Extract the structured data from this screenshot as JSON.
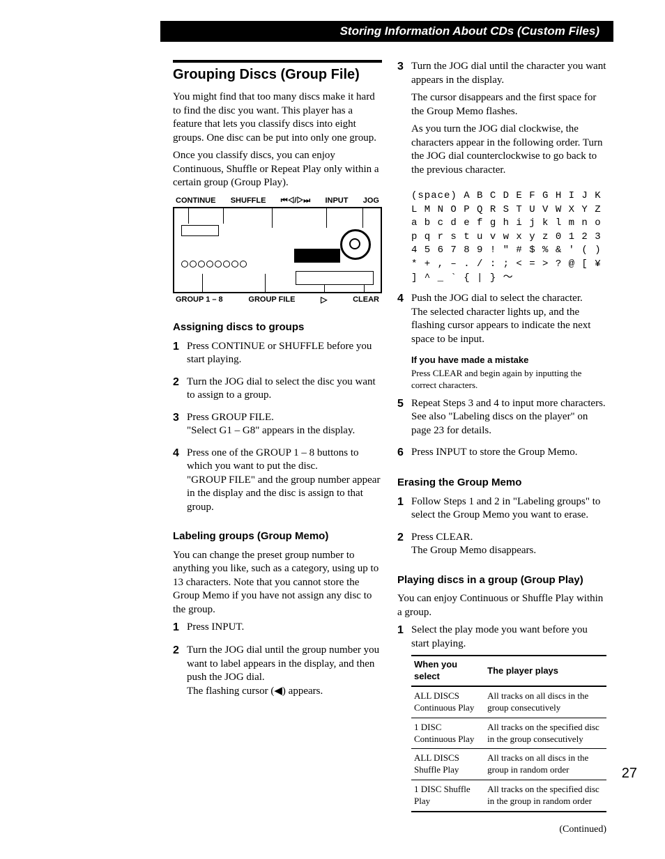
{
  "header": "Storing Information About CDs (Custom Files)",
  "section_title": "Grouping Discs (Group File)",
  "intro1": "You might find that too many discs make it hard to find the disc you want. This player has a feature that lets you classify discs into eight groups. One disc can be put into only one group.",
  "intro2": "Once you classify discs, you can enjoy Continuous, Shuffle or Repeat Play only within a certain group (Group Play).",
  "diagram": {
    "top": [
      "CONTINUE",
      "SHUFFLE",
      "⏮◁/▷⏭",
      "INPUT",
      "JOG"
    ],
    "bot": [
      "GROUP 1 – 8",
      "GROUP FILE",
      "▷",
      "CLEAR"
    ]
  },
  "assign_heading": "Assigning discs to groups",
  "assign_steps": [
    "Press CONTINUE or SHUFFLE before you start playing.",
    "Turn the JOG dial to select the disc you want to assign to a group.",
    "Press GROUP FILE.\n\"Select G1 – G8\" appears in the display.",
    "Press one of the GROUP 1 – 8 buttons to which you want to put the disc.\n\"GROUP FILE\" and the group number appear in the display and the disc is assign to that group."
  ],
  "label_heading": "Labeling groups (Group Memo)",
  "label_intro": "You can change the preset group number to anything you like, such as a category, using up to 13 characters. Note that you cannot store the Group Memo if you have not assign any disc to the group.",
  "label_steps_a": [
    "Press INPUT.",
    "Turn the JOG dial until the group number you want to label appears in the display, and then push the JOG dial.\nThe flashing cursor (◀) appears."
  ],
  "label_step3_a": "Turn the JOG dial until the character you want appears in the display.",
  "label_step3_b": "The cursor disappears and the first space for the Group Memo flashes.",
  "label_step3_c": "As you turn the JOG dial clockwise, the characters appear in the following order. Turn the JOG dial counterclockwise to go back to the previous character.",
  "charset": "(space) A B C D E F G H I J K L M N O P Q R S T U V W X Y Z a b c d e f g h i j k l m n o p q r s t u v w x y z 0 1 2 3 4 5 6 7 8 9 ! \" # $ % & ' ( ) * + , – . / : ; < = > ? @ [ ¥ ] ^ _ ` { | } ～",
  "label_step4": "Push the JOG dial to select the character.\nThe selected character lights up, and the flashing cursor appears to indicate the next space to be input.",
  "mistake_title": "If you have made a mistake",
  "mistake_body": "Press CLEAR and begin again by inputting the correct characters.",
  "label_step5": "Repeat Steps 3 and 4 to input more characters. See also \"Labeling discs on the player\" on page 23 for details.",
  "label_step6": "Press INPUT to store the Group Memo.",
  "erase_heading": "Erasing the Group Memo",
  "erase_steps": [
    "Follow Steps 1 and 2 in \"Labeling groups\" to select the Group Memo you want to erase.",
    "Press CLEAR.\nThe Group Memo disappears."
  ],
  "play_heading": "Playing discs in a group (Group Play)",
  "play_intro": "You can enjoy Continuous or Shuffle Play within a group.",
  "play_step1": "Select the play mode you want before you start playing.",
  "table": {
    "h1": "When you select",
    "h2": "The player plays",
    "rows": [
      [
        "ALL DISCS Continuous Play",
        "All tracks on all discs in the group consecutively"
      ],
      [
        "1 DISC Continuous Play",
        "All tracks on the specified disc in the group consecutively"
      ],
      [
        "ALL DISCS Shuffle Play",
        "All tracks on all discs in the group in random order"
      ],
      [
        "1 DISC Shuffle Play",
        "All tracks on the specified disc in the group in random order"
      ]
    ]
  },
  "continued": "(Continued)",
  "page_number": "27"
}
